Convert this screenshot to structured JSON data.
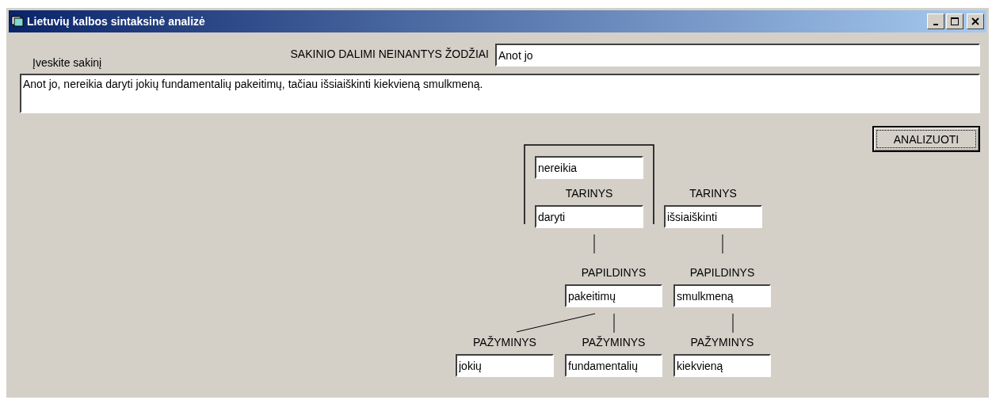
{
  "window": {
    "title": "Lietuvių kalbos sintaksinė analizė"
  },
  "sentence_label": "Įveskite sakinį",
  "excluded_words": {
    "label": "SAKINIO DALIMI NEINANTYS ŽODŽIAI",
    "value": "Anot jo"
  },
  "sentence": {
    "value": "Anot jo, nereikia daryti jokių fundamentalių pakeitimų, tačiau išsiaiškinti kiekvieną smulkmeną."
  },
  "analyze_button": "ANALIZUOTI",
  "predicates": [
    {
      "label": "TARINYS",
      "word": "daryti",
      "bracketed": true,
      "extra_words": [
        "nereikia"
      ],
      "children": [
        {
          "label": "PAPILDINYS",
          "word": "pakeitimų",
          "children": [
            {
              "label": "PAŽYMINYS",
              "word": "jokių"
            },
            {
              "label": "PAŽYMINYS",
              "word": "fundamentalių"
            }
          ]
        }
      ]
    },
    {
      "label": "TARINYS",
      "word": "išsiaiškinti",
      "bracketed": false,
      "children": [
        {
          "label": "PAPILDINYS",
          "word": "smulkmeną",
          "children": [
            {
              "label": "PAŽYMINYS",
              "word": "kiekvieną"
            }
          ]
        }
      ]
    }
  ]
}
